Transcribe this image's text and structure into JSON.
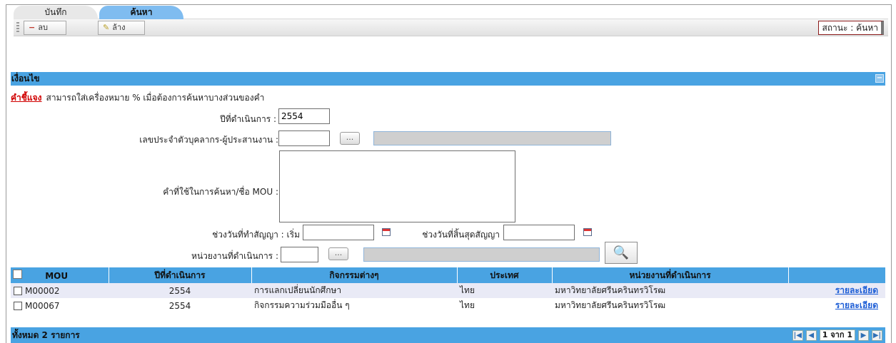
{
  "tabs": [
    {
      "label": "บันทึก",
      "active": false
    },
    {
      "label": "ค้นหา",
      "active": true
    }
  ],
  "toolbar": {
    "delete_label": "ลบ",
    "clear_label": "ล้าง",
    "status_text": "สถานะ : ค้นหา"
  },
  "panel": {
    "title": "เงื่อนไข",
    "hint_key": "คำชี้แจง",
    "hint_text": "สามารถใส่เครื่องหมาย % เมื่อต้องการค้นหาบางส่วนของคำ",
    "fields": {
      "year_label": "ปีที่ดำเนินการ :",
      "year_value": "2554",
      "person_label": "เลขประจำตัวบุคลากร-ผู้ประสานงาน :",
      "person_value": "",
      "keyword_label": "คำที่ใช้ในการค้นหา/ชื่อ MOU :",
      "keyword_value": "",
      "sign_range_label": "ช่วงวันที่ทำสัญญา : เริ่ม",
      "sign_start_value": "",
      "end_range_label": "ช่วงวันที่สิ้นสุดสัญญา",
      "end_value": "",
      "unit_label": "หน่วยงานที่ดำเนินการ :",
      "unit_value": "",
      "browse_label": "..."
    }
  },
  "grid": {
    "columns": [
      "MOU",
      "ปีที่ดำเนินการ",
      "กิจกรรมต่างๆ",
      "ประเทศ",
      "หน่วยงานที่ดำเนินการ",
      ""
    ],
    "rows": [
      {
        "mou": "M00002",
        "year": "2554",
        "activity": "การแลกเปลี่ยนนักศึกษา",
        "country": "ไทย",
        "unit": "มหาวิทยาลัยศรีนครินทรวิโรฒ",
        "link": "รายละเอียด"
      },
      {
        "mou": "M00067",
        "year": "2554",
        "activity": "กิจกรรมความร่วมมืออื่น ๆ",
        "country": "ไทย",
        "unit": "มหาวิทยาลัยศรีนครินทรวิโรฒ",
        "link": "รายละเอียด"
      }
    ],
    "total_text": "ทั้งหมด 2 รายการ",
    "pager_text": "1 จาก 1"
  }
}
